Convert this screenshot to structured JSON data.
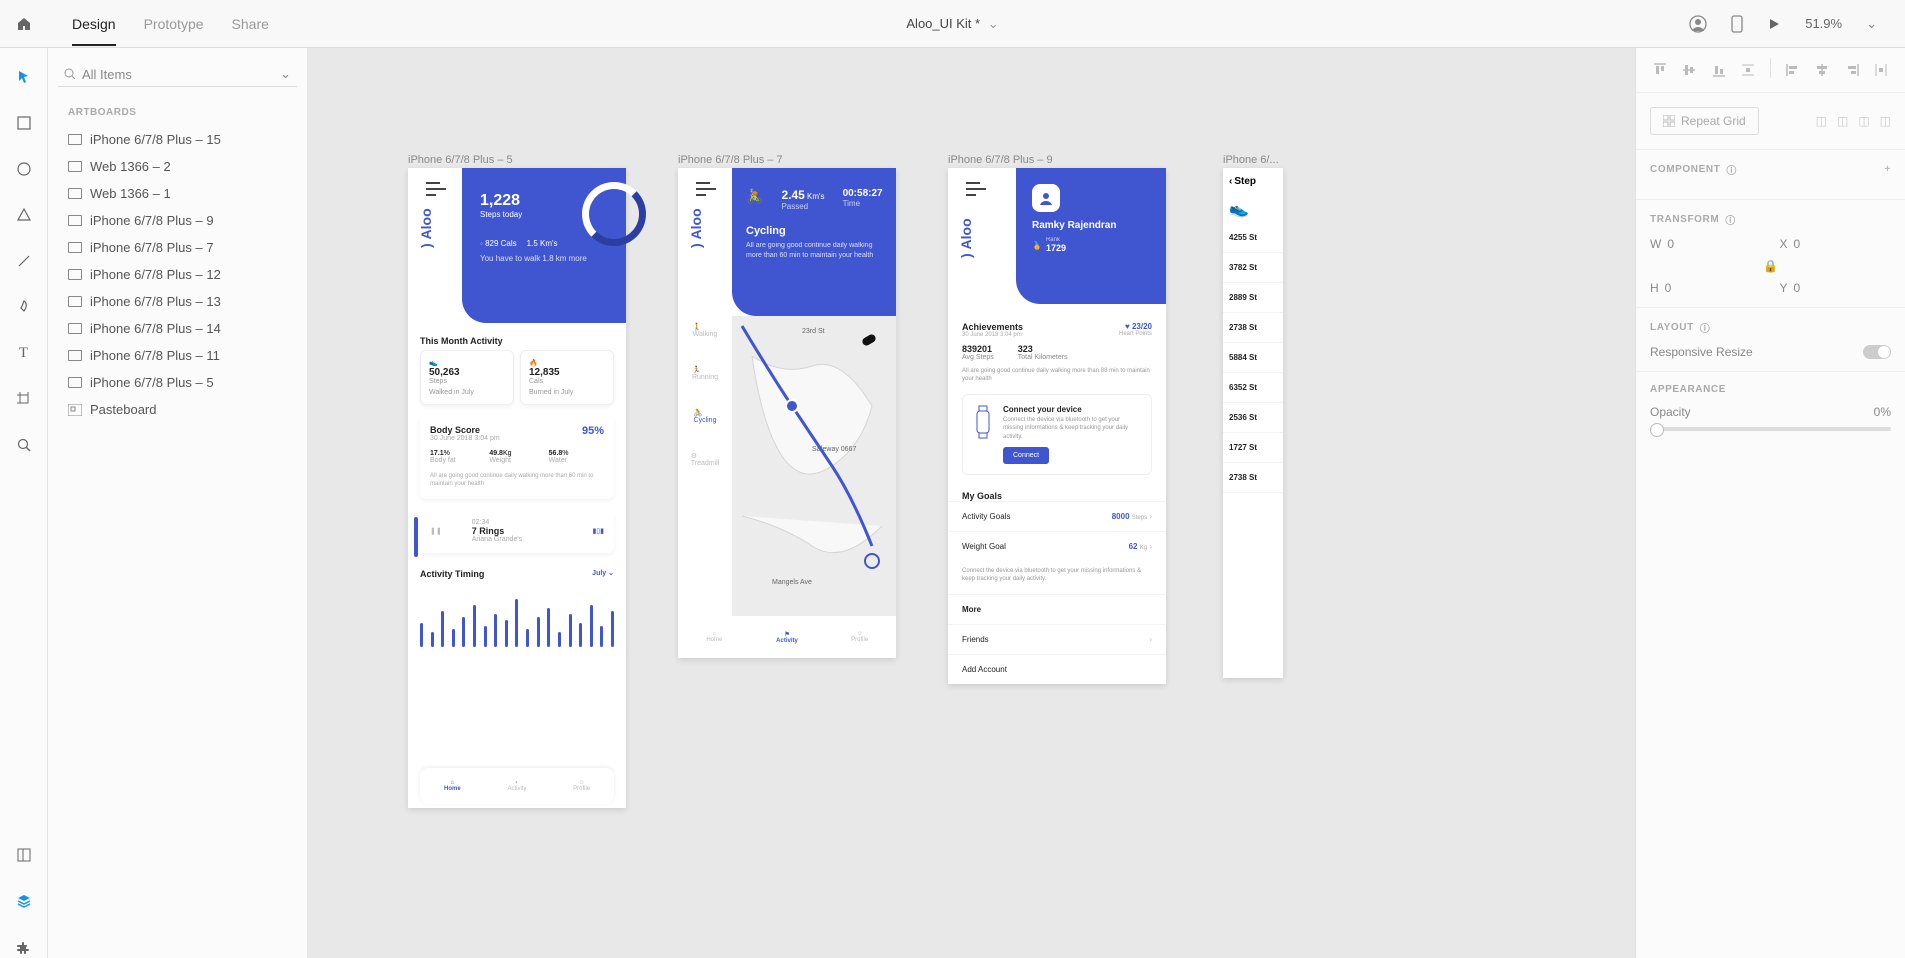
{
  "topbar": {
    "tabs": [
      "Design",
      "Prototype",
      "Share"
    ],
    "doc_title": "Aloo_UI Kit *",
    "zoom": "51.9%"
  },
  "left_panel": {
    "search_placeholder": "All Items",
    "artboards_label": "ARTBOARDS",
    "items": [
      "iPhone 6/7/8 Plus – 15",
      "Web 1366 – 2",
      "Web 1366 – 1",
      "iPhone 6/7/8 Plus – 9",
      "iPhone 6/7/8 Plus – 7",
      "iPhone 6/7/8 Plus – 12",
      "iPhone 6/7/8 Plus – 13",
      "iPhone 6/7/8 Plus – 14",
      "iPhone 6/7/8 Plus – 11",
      "iPhone 6/7/8 Plus – 5"
    ],
    "pasteboard": "Pasteboard"
  },
  "right_panel": {
    "repeat_grid": "Repeat Grid",
    "component": "COMPONENT",
    "transform": "TRANSFORM",
    "w": "0",
    "x": "0",
    "h": "0",
    "y": "0",
    "layout": "LAYOUT",
    "responsive": "Responsive Resize",
    "appearance": "APPEARANCE",
    "opacity_label": "Opacity",
    "opacity_val": "0%"
  },
  "canvas": {
    "labels": [
      "iPhone 6/7/8 Plus – 5",
      "iPhone 6/7/8 Plus – 7",
      "iPhone 6/7/8 Plus – 9",
      "iPhone 6/..."
    ],
    "ab5": {
      "brand": "Aloo",
      "steps_val": "1,228",
      "steps_lbl": "Steps today",
      "cals": "829 Cals",
      "kms": "1.5 Km's",
      "note": "You have to walk 1.8 km more",
      "section_month": "This Month Activity",
      "card1_val": "50,263",
      "card1_lbl": "Steps",
      "card1_sub": "Walked in July",
      "card2_val": "12,835",
      "card2_lbl": "Cals",
      "card2_sub": "Burned in July",
      "body_title": "Body Score",
      "body_date": "30 June 2018 3:04 pm",
      "body_pct": "95%",
      "bf": "17.1",
      "bf_u": "%",
      "bf_l": "Body fat",
      "wt": "49.8",
      "wt_u": "Kg",
      "wt_l": "Weight",
      "wa": "56.8",
      "wa_u": "%",
      "wa_l": "Water",
      "body_note": "All are going good continue daily walking more than 60 min to maintain your health",
      "music_time": "02:34",
      "music_title": "7 Rings",
      "music_artist": "Ariana Grande's",
      "timing_title": "Activity Timing",
      "timing_sel": "July",
      "nav": [
        "Home",
        "Activity",
        "Profile"
      ]
    },
    "ab7": {
      "brand": "Aloo",
      "dist": "2.45",
      "dist_u": "Km's",
      "dist_l": "Passed",
      "time": "00:58:27",
      "time_l": "Time",
      "title": "Cycling",
      "note": "All are going good continue daily walking more than 60 min to maintain your health",
      "side": [
        "Walking",
        "Running",
        "Cycling",
        "Treadmill"
      ],
      "nav": [
        "Home",
        "Activity",
        "Profile"
      ],
      "map_labels": [
        "23rd St",
        "Safeway 0667",
        "Mangels Ave"
      ]
    },
    "ab9": {
      "brand": "Aloo",
      "name": "Ramky Rajendran",
      "rank_l": "Rank",
      "rank": "1729",
      "ach_title": "Achievements",
      "ach_date": "30 June 2018 3:04 pm",
      "ach_badge": "23/20",
      "ach_badge_l": "Heart Points",
      "avg_steps": "839201",
      "avg_steps_l": "Avg Steps",
      "total_km": "323",
      "total_km_l": "Total Kilometers",
      "ach_note": "All are going good continue daily walking more than 88 min to maintain your health",
      "conn_title": "Connect your device",
      "conn_note": "Connect the device via bluetooth to get your missing informations & keep tracking your daily activity.",
      "conn_btn": "Connect",
      "goals_title": "My Goals",
      "g1": "Activity Goals",
      "g1_v": "8000",
      "g1_u": "Steps",
      "g2": "Weight Goal",
      "g2_v": "62",
      "g2_u": "Kg",
      "g_note": "Connect the device via bluetooth to get your missing informations & keep tracking your daily activity.",
      "more": "More",
      "friends": "Friends",
      "add_acc": "Add Account"
    },
    "abp": {
      "title": "Step",
      "rows": [
        "4255",
        "3782",
        "2889",
        "2738",
        "5884",
        "6352",
        "2536",
        "1727",
        "2738"
      ]
    }
  }
}
